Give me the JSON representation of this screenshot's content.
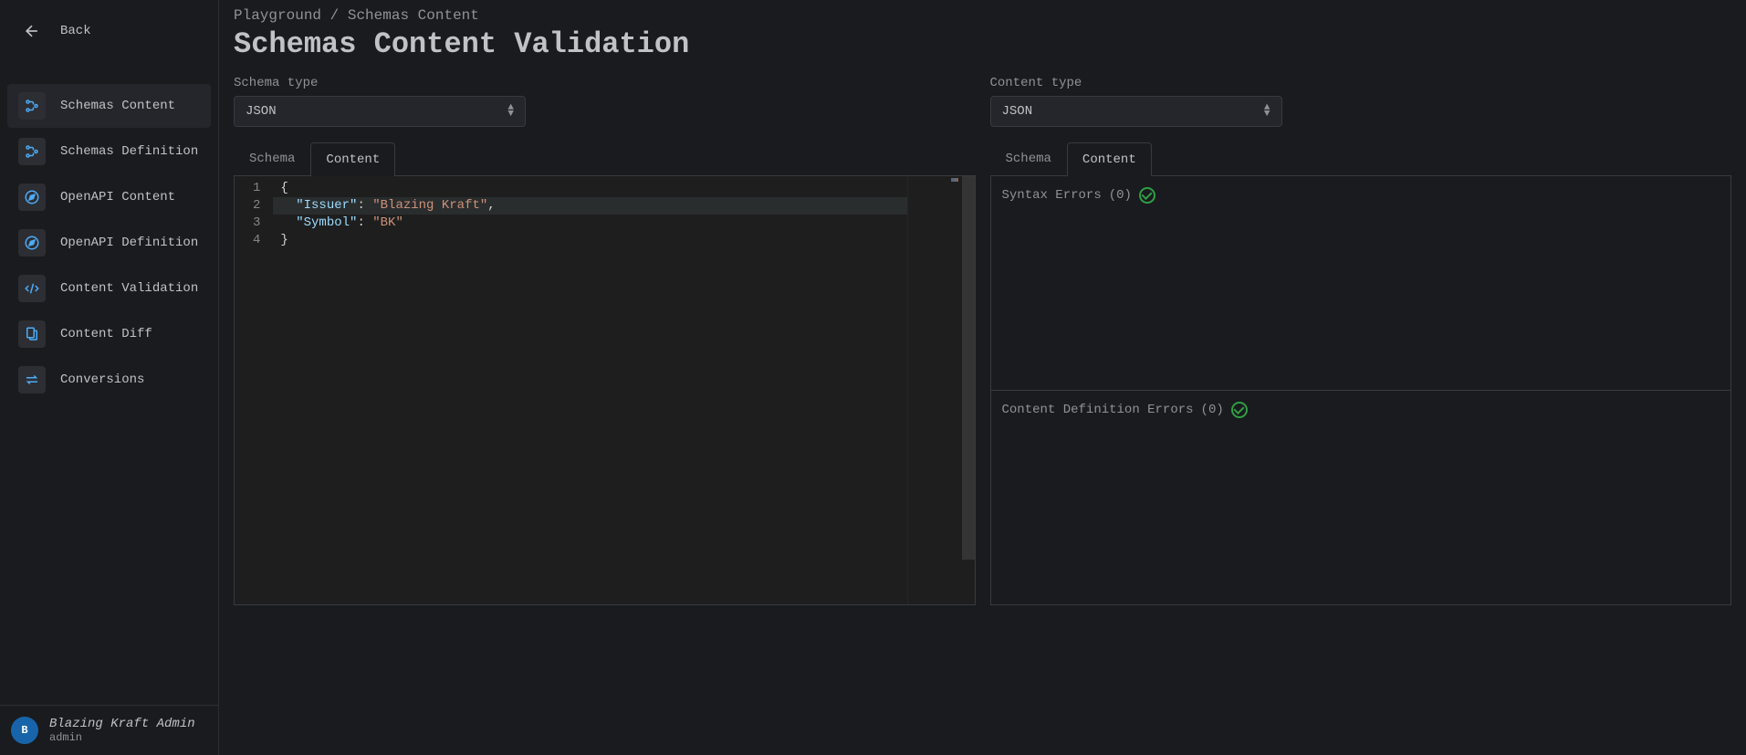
{
  "sidebar": {
    "back_label": "Back",
    "items": [
      {
        "label": "Schemas Content",
        "active": true
      },
      {
        "label": "Schemas Definition",
        "active": false
      },
      {
        "label": "OpenAPI Content",
        "active": false
      },
      {
        "label": "OpenAPI Definition",
        "active": false
      },
      {
        "label": "Content Validation",
        "active": false
      },
      {
        "label": "Content Diff",
        "active": false
      },
      {
        "label": "Conversions",
        "active": false
      }
    ]
  },
  "user": {
    "avatar_initial": "B",
    "name": "Blazing Kraft Admin",
    "role": "admin"
  },
  "breadcrumb": {
    "parent": "Playground",
    "separator": "/",
    "current": "Schemas Content"
  },
  "page_title": "Schemas Content Validation",
  "left_panel": {
    "type_label": "Schema type",
    "type_value": "JSON",
    "tabs": {
      "schema": "Schema",
      "content": "Content",
      "active": "content"
    },
    "editor": {
      "line_numbers": [
        "1",
        "2",
        "3",
        "4"
      ],
      "highlighted_line": 2,
      "content_data": {
        "Issuer": "Blazing Kraft",
        "Symbol": "BK"
      }
    }
  },
  "right_panel": {
    "type_label": "Content type",
    "type_value": "JSON",
    "tabs": {
      "schema": "Schema",
      "content": "Content",
      "active": "content"
    },
    "syntax_errors": {
      "label": "Syntax Errors",
      "count": 0
    },
    "definition_errors": {
      "label": "Content Definition Errors",
      "count": 0
    }
  }
}
